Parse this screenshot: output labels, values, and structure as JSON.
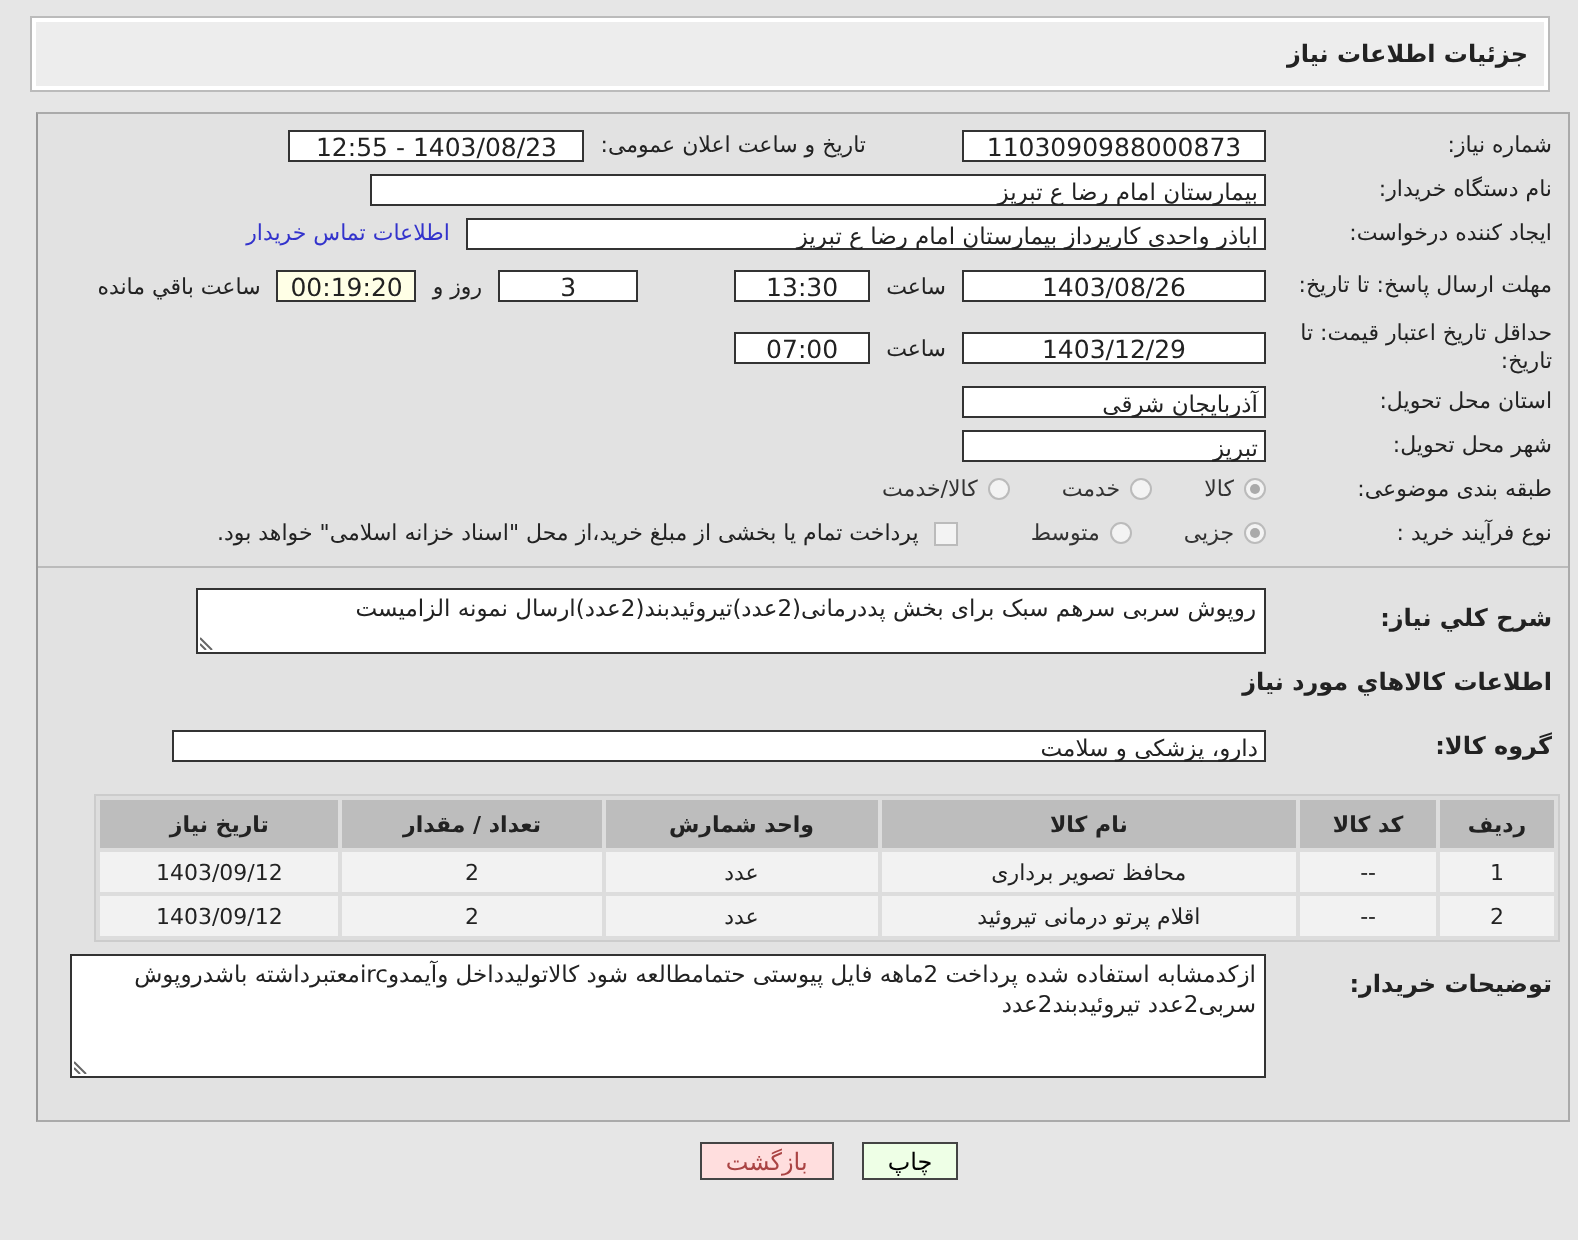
{
  "header": {
    "title": "جزئیات اطلاعات نیاز"
  },
  "need_number": {
    "label": "شماره نیاز:",
    "value": "1103090988000873"
  },
  "announce": {
    "label": "تاریخ و ساعت اعلان عمومی:",
    "value": "1403/08/23 - 12:55"
  },
  "buyer": {
    "label": "نام دستگاه خریدار:",
    "value": "بیمارستان امام رضا  ع  تبریز"
  },
  "creator": {
    "label": "ایجاد کننده درخواست:",
    "value": "اباذر واحدی کارپرداز بیمارستان امام رضا  ع  تبریز",
    "link": "اطلاعات تماس خریدار"
  },
  "deadline": {
    "label": "مهلت ارسال پاسخ: تا تاریخ:",
    "date": "1403/08/26",
    "time_label": "ساعت",
    "time": "13:30",
    "days": "3",
    "days_label": "روز و",
    "remaining": "00:19:20",
    "remaining_label": "ساعت باقي مانده"
  },
  "validity": {
    "label": "حداقل تاریخ اعتبار قیمت: تا تاریخ:",
    "date": "1403/12/29",
    "time_label": "ساعت",
    "time": "07:00"
  },
  "province": {
    "label": "استان محل تحویل:",
    "value": "آذربایجان شرقی"
  },
  "city": {
    "label": "شهر محل تحویل:",
    "value": "تبریز"
  },
  "category": {
    "label": "طبقه بندی موضوعی:",
    "options": [
      {
        "label": "کالا",
        "selected": true
      },
      {
        "label": "خدمت",
        "selected": false
      },
      {
        "label": "کالا/خدمت",
        "selected": false
      }
    ]
  },
  "process": {
    "label": "نوع فرآیند خرید :",
    "options": [
      {
        "label": "جزیی",
        "selected": true
      },
      {
        "label": "متوسط",
        "selected": false
      }
    ],
    "treasury": {
      "checked": false,
      "text": "پرداخت تمام یا بخشی از مبلغ خرید،از محل \"اسناد خزانه اسلامی\" خواهد بود."
    }
  },
  "description": {
    "label": "شرح کلي نياز:",
    "value": "روپوش سربی سرهم سبک برای بخش پددرمانی(2عدد)تیروئیدبند(2عدد)ارسال نمونه الزامیست"
  },
  "goods_heading": "اطلاعات کالاهاي مورد نياز",
  "goods_group": {
    "label": "گروه کالا:",
    "value": "دارو، پزشکی و سلامت"
  },
  "table": {
    "columns": [
      "ردیف",
      "کد کالا",
      "نام کالا",
      "واحد شمارش",
      "تعداد / مقدار",
      "تاریخ نیاز"
    ],
    "rows": [
      [
        "1",
        "--",
        "محافظ تصویر برداری",
        "عدد",
        "2",
        "1403/09/12"
      ],
      [
        "2",
        "--",
        "اقلام پرتو درمانی تیروئید",
        "عدد",
        "2",
        "1403/09/12"
      ]
    ]
  },
  "buyer_notes": {
    "label": "توضیحات خریدار:",
    "value": "ازکدمشابه استفاده شده پرداخت 2ماهه فایل پیوستی حتمامطالعه شود کالاتولیدداخل وآیمدوircمعتبرداشته باشدروپوش سربی2عدد تیروئیدبند2عدد"
  },
  "buttons": [
    {
      "label": "چاپ",
      "kind": "print"
    },
    {
      "label": "بازگشت",
      "kind": "back"
    }
  ]
}
